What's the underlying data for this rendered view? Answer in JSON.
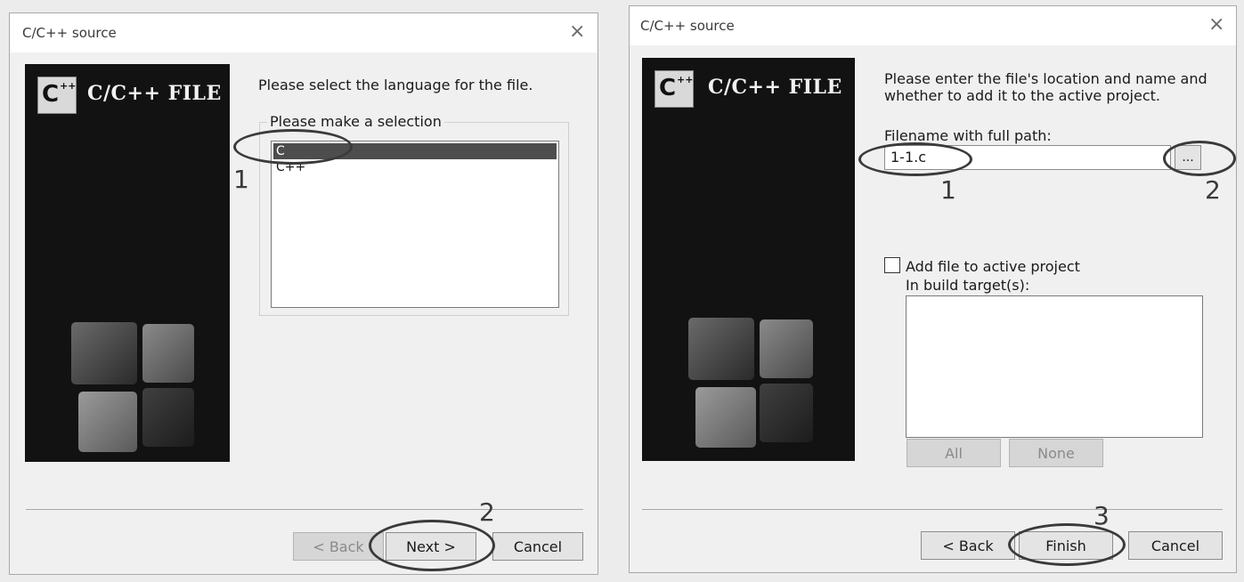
{
  "dialog1": {
    "title": "C/C++ source",
    "close_glyph": "×",
    "banner_title": "C/C++ FILE",
    "logo_c": "C",
    "logo_pp": "++",
    "prompt": "Please select the language for the file.",
    "group_label": "Please make a selection",
    "options": [
      "C",
      "C++"
    ],
    "selected_option": "C",
    "buttons": {
      "back": "< Back",
      "next": "Next >",
      "cancel": "Cancel"
    },
    "annotations": [
      "1",
      "2"
    ]
  },
  "dialog2": {
    "title": "C/C++ source",
    "close_glyph": "×",
    "banner_title": "C/C++ FILE",
    "logo_c": "C",
    "logo_pp": "++",
    "prompt_line1": "Please enter the file's location and name and",
    "prompt_line2": "whether to add it to the active project.",
    "filename_label": "Filename with full path:",
    "filename_value": "1-1.c",
    "browse_label": "...",
    "add_to_project_label": "Add file to active project",
    "add_to_project_checked": false,
    "build_targets_label": "In build target(s):",
    "buttons": {
      "all": "All",
      "none": "None",
      "back": "< Back",
      "finish": "Finish",
      "cancel": "Cancel"
    },
    "annotations": [
      "1",
      "2",
      "3"
    ]
  },
  "colors": {
    "banner_bg": "#121212",
    "dialog_bg": "#f0f0f0",
    "annotation": "#3a3a3a",
    "selection": "#4d4d4d"
  }
}
